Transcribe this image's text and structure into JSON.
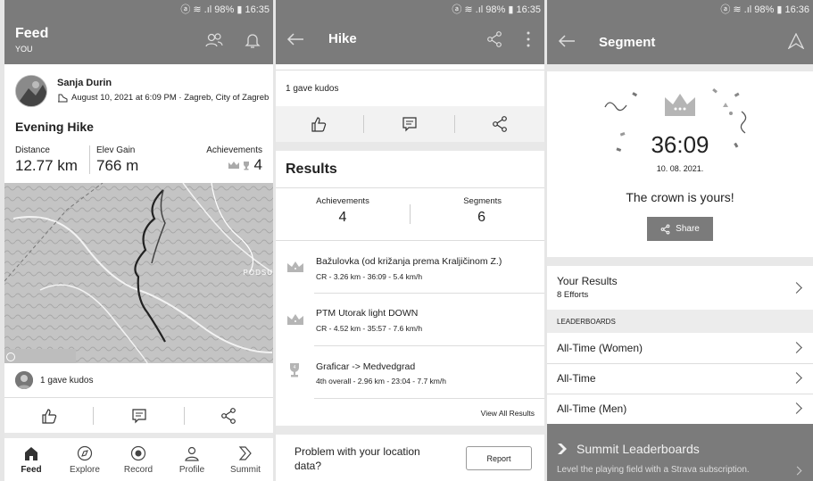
{
  "status": {
    "p1": "ⓐ ≋ .ıl 98% ▮ 16:35",
    "p2": "ⓐ ≋ .ıl 98% ▮ 16:35",
    "p3": "ⓐ ≋ .ıl 98% ▮ 16:36"
  },
  "feed": {
    "title": "Feed",
    "subtitle": "YOU",
    "athlete": "Sanja Durin",
    "meta": "August 10, 2021 at 6:09 PM · Zagreb, City of Zagreb",
    "activity_title": "Evening Hike",
    "stats": {
      "distance_label": "Distance",
      "distance_value": "12.77 km",
      "elev_label": "Elev Gain",
      "elev_value": "766 m",
      "ach_label": "Achievements",
      "ach_value": "4"
    },
    "map_label": "PODSU",
    "kudos": "1 gave kudos",
    "nav": [
      {
        "label": "Feed"
      },
      {
        "label": "Explore"
      },
      {
        "label": "Record"
      },
      {
        "label": "Profile"
      },
      {
        "label": "Summit"
      }
    ]
  },
  "hike": {
    "title": "Hike",
    "kudos": "1 gave kudos",
    "results_title": "Results",
    "achievements_label": "Achievements",
    "achievements_value": "4",
    "segments_label": "Segments",
    "segments_value": "6",
    "segments": [
      {
        "name": "Bažulovka (od križanja prema Kraljičinom Z.)",
        "detail": "CR - 3.26 km - 36:09 - 5.4 km/h"
      },
      {
        "name": "PTM Utorak light DOWN",
        "detail": "CR - 4.52 km - 35:57 - 7.6 km/h"
      },
      {
        "name": "Graficar -> Medvedgrad",
        "detail": "4th overall - 2.96 km - 23:04 - 7.7 km/h"
      }
    ],
    "view_all": "View All Results",
    "problem": "Problem with your location data?",
    "report": "Report"
  },
  "segment": {
    "title": "Segment",
    "time": "36:09",
    "date": "10. 08. 2021.",
    "crown_text": "The crown is yours!",
    "share": "Share",
    "your_results": "Your Results",
    "efforts": "8 Efforts",
    "leaderboards_header": "LEADERBOARDS",
    "leaderboards": [
      {
        "label": "All-Time (Women)"
      },
      {
        "label": "All-Time"
      },
      {
        "label": "All-Time (Men)"
      }
    ],
    "summit_title": "Summit Leaderboards",
    "summit_sub": "Level the playing field with a Strava subscription."
  },
  "colors": {
    "bar": "#7b7b7b",
    "text": "#222222",
    "divider": "#dddddd"
  }
}
